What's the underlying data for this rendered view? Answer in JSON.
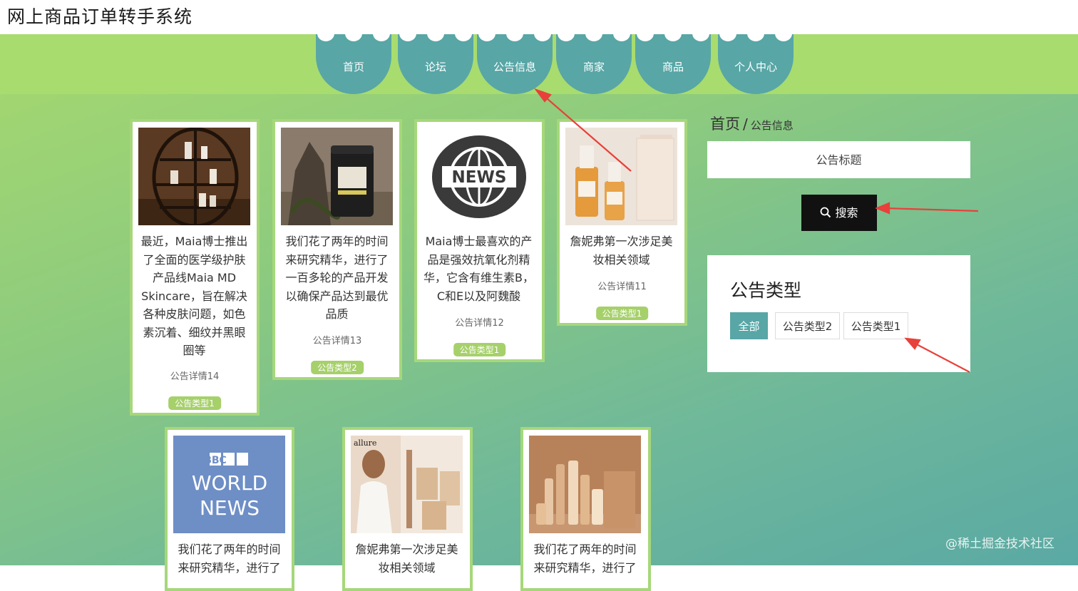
{
  "site": {
    "title": "网上商品订单转手系统"
  },
  "nav": [
    {
      "label": "首页"
    },
    {
      "label": "论坛"
    },
    {
      "label": "公告信息"
    },
    {
      "label": "商家"
    },
    {
      "label": "商品"
    },
    {
      "label": "个人中心"
    }
  ],
  "breadcrumb": {
    "home": "首页",
    "separator": "/",
    "current": "公告信息"
  },
  "search": {
    "placeholder": "公告标题",
    "button_label": "搜索",
    "icon": "search-icon"
  },
  "categories": {
    "title": "公告类型",
    "options": [
      {
        "label": "全部",
        "active": true
      },
      {
        "label": "公告类型2",
        "active": false
      },
      {
        "label": "公告类型1",
        "active": false
      }
    ]
  },
  "cards": [
    {
      "title": "最近，Maia博士推出了全面的医学级护肤产品线Maia MD Skincare，旨在解决各种皮肤问题，如色素沉着、细纹并黑眼圈等",
      "detail": "公告详情14",
      "tag": "公告类型1",
      "image": "skincare-shelf-image"
    },
    {
      "title": "我们花了两年的时间来研究精华，进行了一百多轮的产品开发以确保产品达到最优品质",
      "detail": "公告详情13",
      "tag": "公告类型2",
      "image": "supplement-jar-image"
    },
    {
      "title": "Maia博士最喜欢的产品是强效抗氧化剂精华，它含有维生素B，C和E以及阿魏酸",
      "detail": "公告详情12",
      "tag": "公告类型1",
      "image": "news-globe-image"
    },
    {
      "title": "詹妮弗第一次涉足美妆相关领域",
      "detail": "公告详情11",
      "tag": "公告类型1",
      "image": "serum-bottles-image"
    },
    {
      "title": "我们花了两年的时间来研究精华，进行了",
      "detail": "",
      "tag": "",
      "image": "bbc-world-news-image",
      "image_text": [
        "BBC",
        "WORLD",
        "NEWS"
      ]
    },
    {
      "title": "詹妮弗第一次涉足美妆相关领域",
      "detail": "",
      "tag": "",
      "image": "magazine-beauty-image",
      "image_text": [
        "allure"
      ]
    },
    {
      "title": "我们花了两年的时间来研究精华，进行了",
      "detail": "",
      "tag": "",
      "image": "cosmetics-set-image"
    }
  ],
  "watermark": "@稀土掘金技术社区",
  "colors": {
    "nav_tab": "#58a6a6",
    "nav_strip": "#a8dc6e",
    "tag": "#a6d06a",
    "card_border": "#a6d77a",
    "search_button": "#111111",
    "active_category": "#58a6a6",
    "annotation_arrow": "#e8403a"
  }
}
